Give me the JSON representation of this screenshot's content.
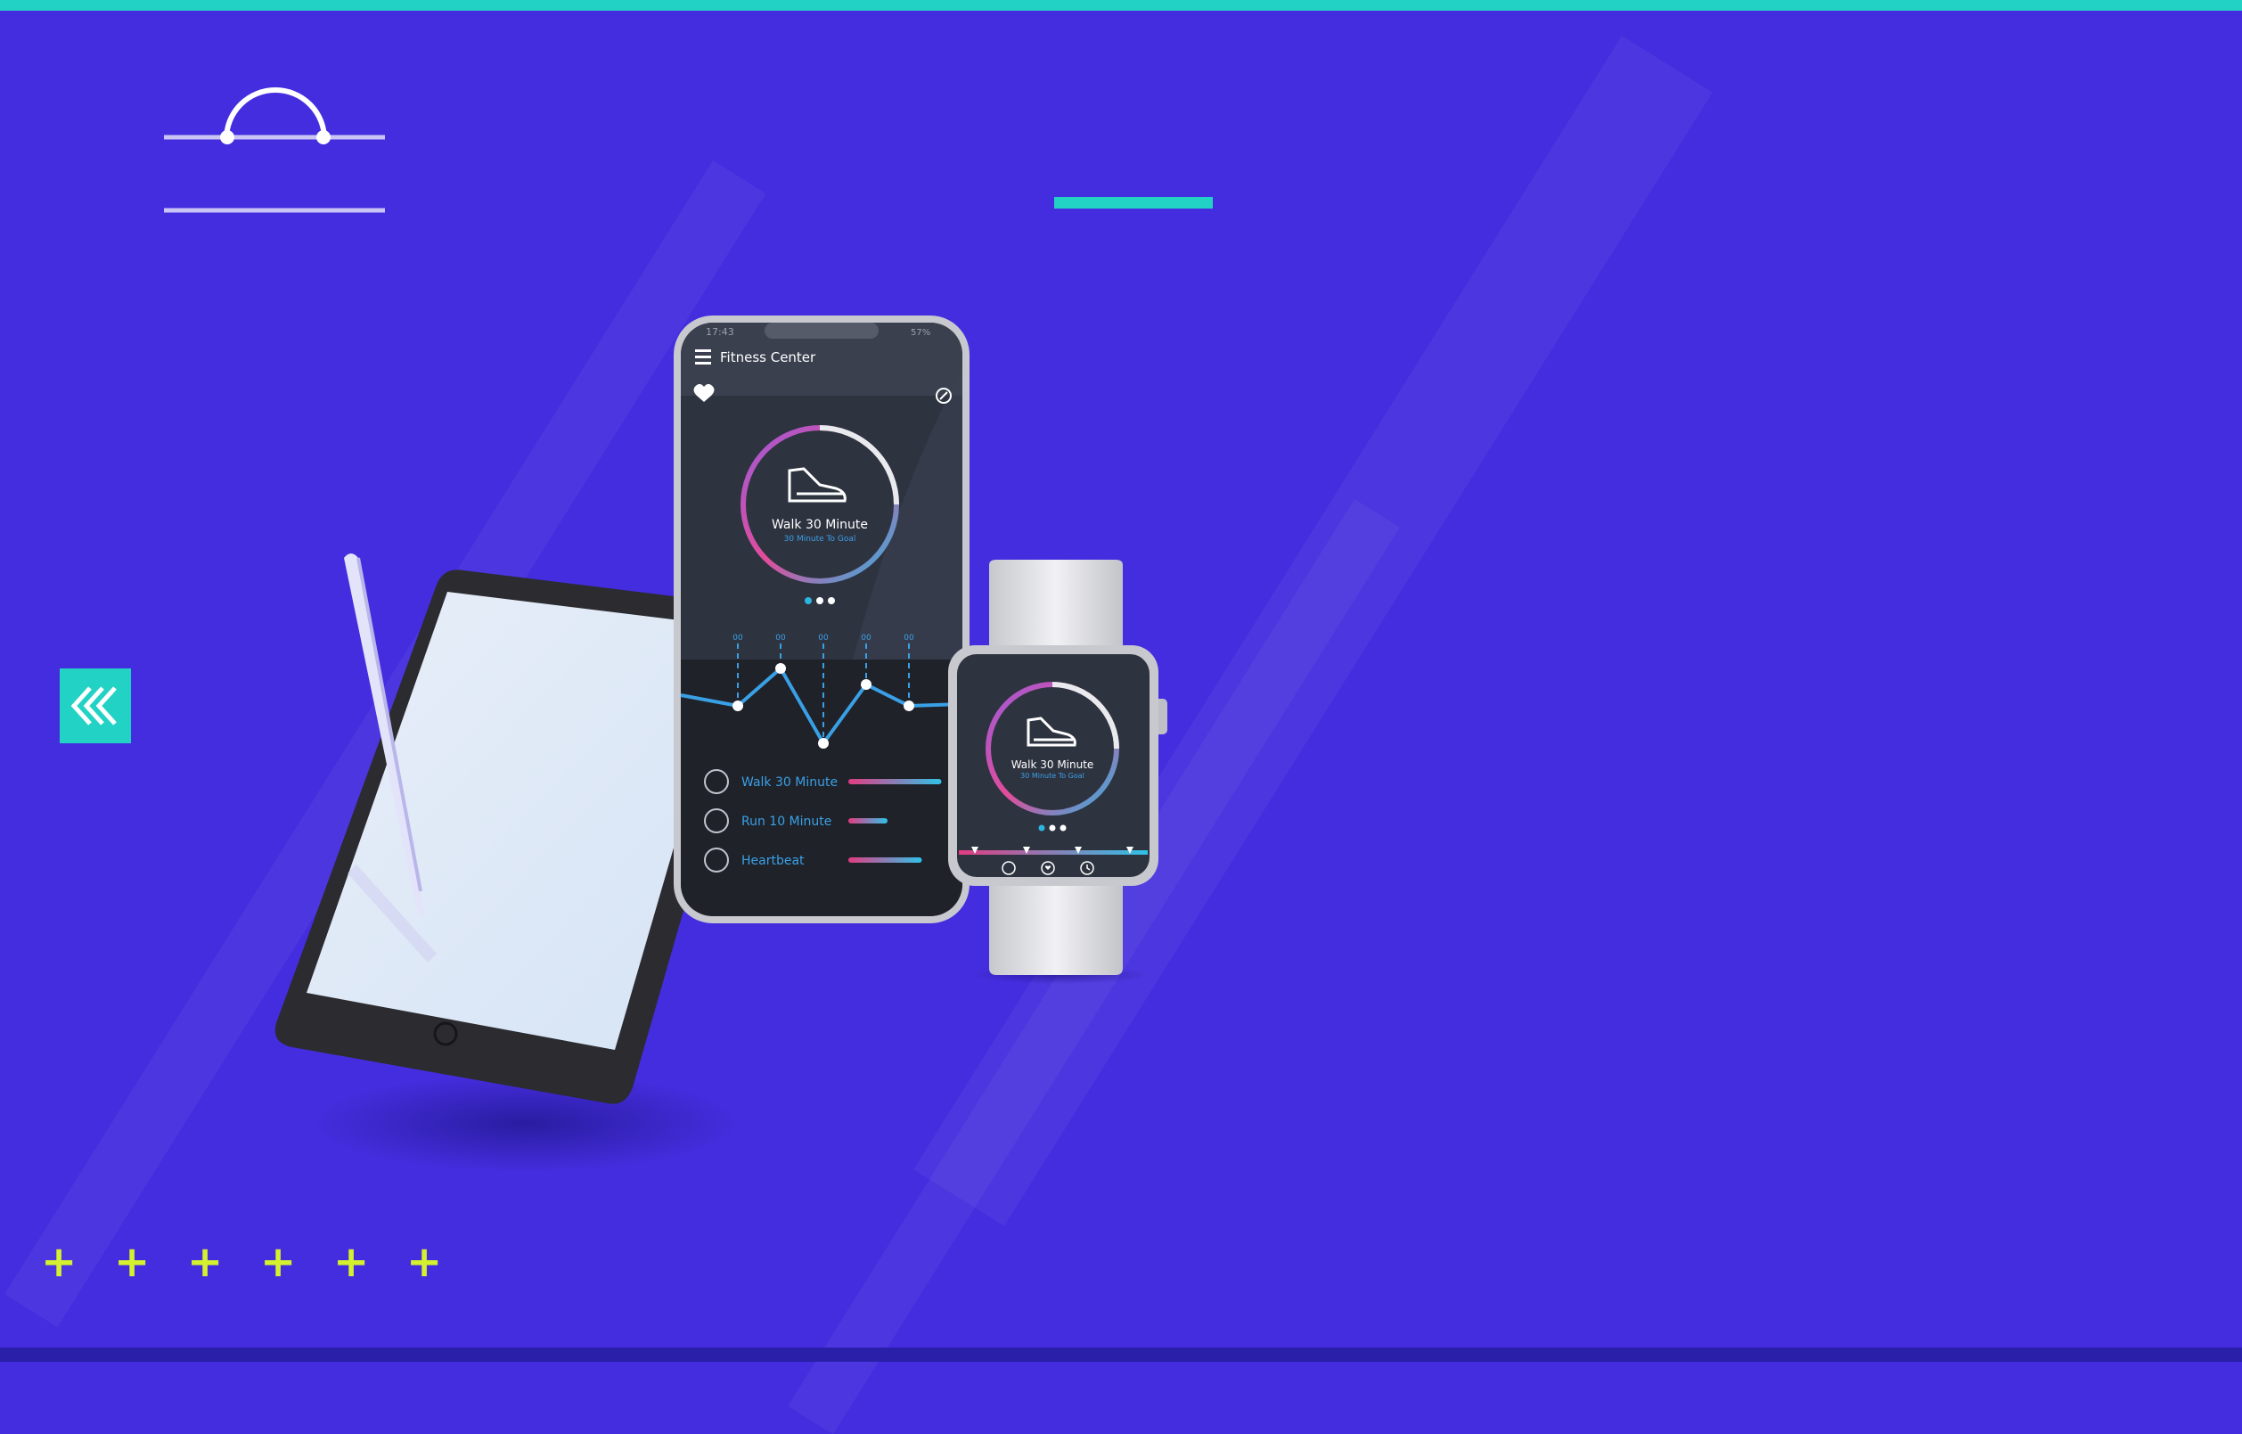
{
  "phone": {
    "status_time": "17:43",
    "status_battery": "57%",
    "app_title": "Fitness Center",
    "goal_title": "Walk 30 Minute",
    "goal_subtitle": "30 Minute To Goal",
    "chart_labels": [
      "00",
      "00",
      "00",
      "00",
      "00"
    ],
    "activities": [
      {
        "label": "Walk 30 Minute",
        "icon": "clock-icon",
        "progress": 0.95
      },
      {
        "label": "Run 10 Minute",
        "icon": "runner-icon",
        "progress": 0.4
      },
      {
        "label": "Heartbeat",
        "icon": "heart-icon",
        "progress": 0.75
      }
    ]
  },
  "watch": {
    "goal_title": "Walk 30 Minute",
    "goal_subtitle": "30 Minute To Goal",
    "nav_icons": [
      "timer-icon",
      "heart-icon",
      "clock-icon"
    ]
  },
  "decor": {
    "plus_glyph": "+",
    "plus_count": 6,
    "back_icon": "double-chevron-left-icon"
  },
  "colors": {
    "background": "#442dde",
    "accent": "#22d3c5",
    "plus": "#d4f02e",
    "screen": "#2e3340",
    "link": "#3aa0e6"
  }
}
